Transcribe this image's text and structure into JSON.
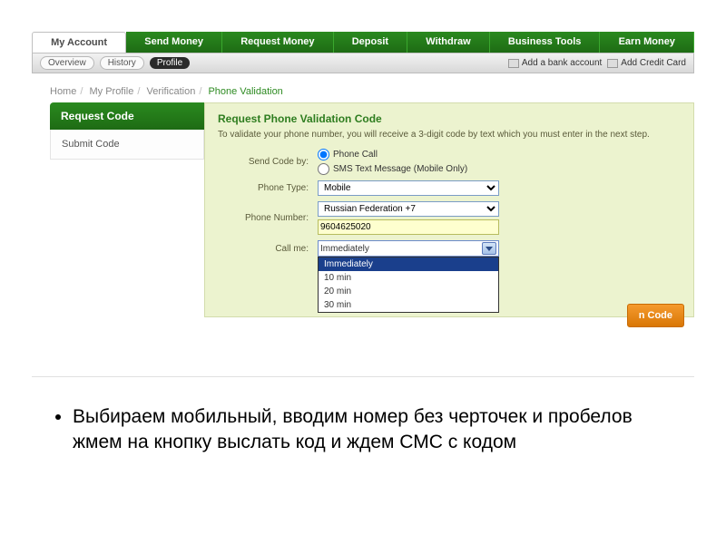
{
  "topnav": {
    "tabs": [
      "My Account",
      "Send Money",
      "Request Money",
      "Deposit",
      "Withdraw",
      "Business Tools",
      "Earn Money"
    ],
    "active": "My Account"
  },
  "subnav": {
    "items": [
      {
        "label": "Overview",
        "dark": false
      },
      {
        "label": "History",
        "dark": false
      },
      {
        "label": "Profile",
        "dark": true
      }
    ],
    "right": [
      {
        "label": "Add a bank account"
      },
      {
        "label": "Add Credit Card"
      }
    ]
  },
  "breadcrumbs": {
    "items": [
      "Home",
      "My Profile",
      "Verification"
    ],
    "current": "Phone Validation"
  },
  "left": {
    "head": "Request Code",
    "sub": "Submit Code"
  },
  "panel": {
    "title": "Request Phone Validation Code",
    "desc": "To validate your phone number, you will receive a 3-digit code by text which you must enter in the next step.",
    "labels": {
      "sendby": "Send Code by:",
      "ptype": "Phone Type:",
      "pnum": "Phone Number:",
      "callme": "Call me:"
    },
    "radios": {
      "phone": "Phone Call",
      "sms": "SMS Text Message (Mobile Only)"
    },
    "phone_type": "Mobile",
    "country": "Russian Federation +7",
    "number": "9604625020",
    "callme_value": "Immediately",
    "callme_options": [
      "Immediately",
      "10 min",
      "20 min",
      "30 min"
    ],
    "button": "n Code"
  },
  "bullets": {
    "text": "Выбираем мобильный, вводим номер без черточек и пробелов жмем на кнопку выслать код и ждем СМС с кодом"
  }
}
